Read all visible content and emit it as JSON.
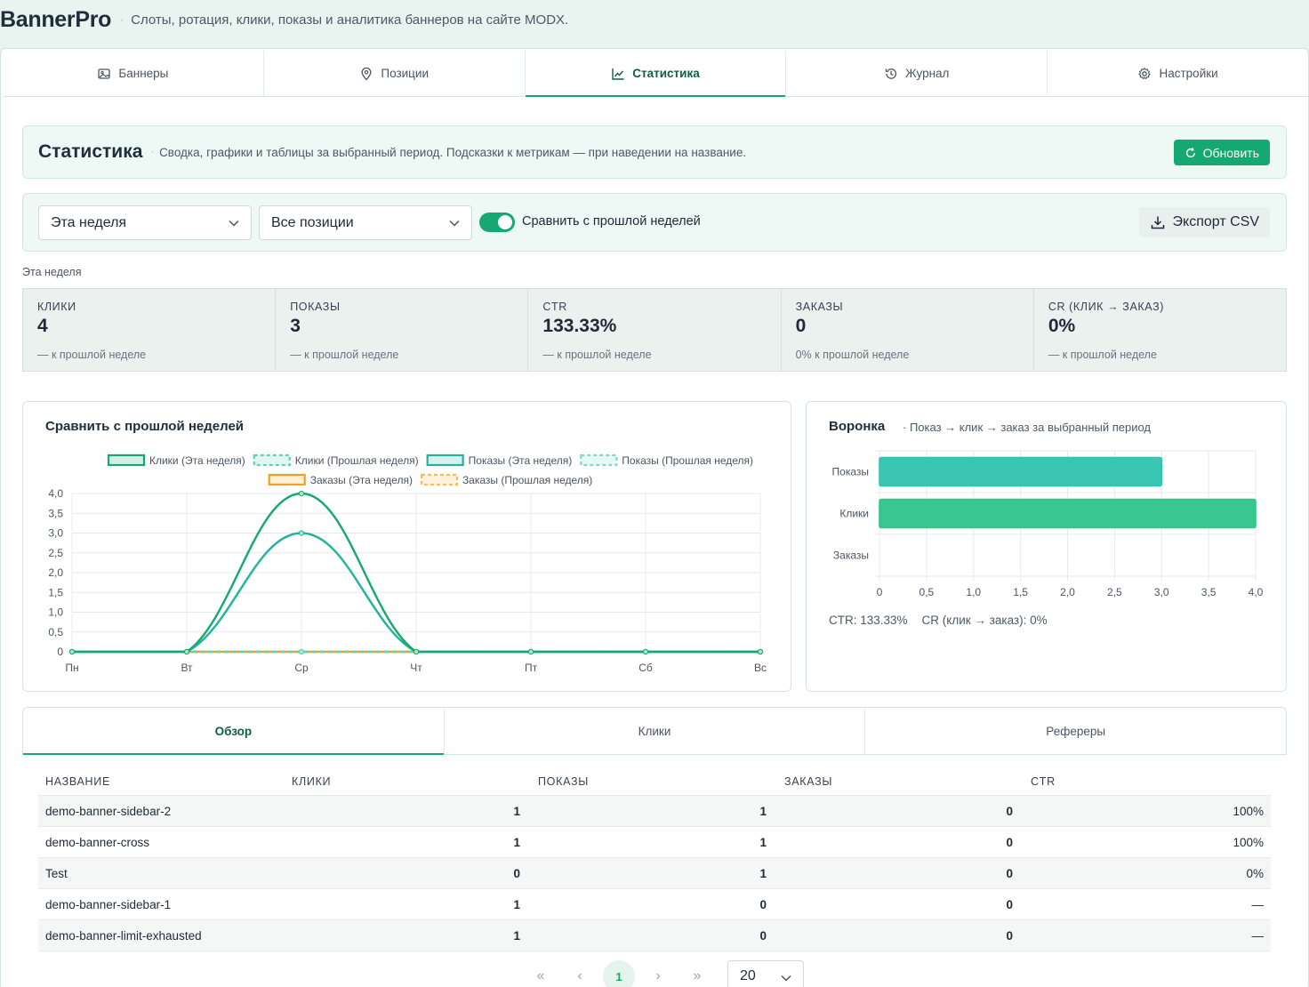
{
  "app": {
    "title": "BannerPro",
    "separator": "·",
    "subtitle": "Слоты, ротация, клики, показы и аналитика баннеров на сайте MODX."
  },
  "top_tabs": [
    {
      "label": "Баннеры",
      "icon": "image-icon"
    },
    {
      "label": "Позиции",
      "icon": "map-pin-icon"
    },
    {
      "label": "Статистика",
      "icon": "chart-line-icon",
      "active": true
    },
    {
      "label": "Журнал",
      "icon": "history-icon"
    },
    {
      "label": "Настройки",
      "icon": "gear-icon"
    }
  ],
  "stats_header": {
    "title": "Статистика",
    "subtitle": "Сводка, графики и таблицы за выбранный период. Подсказки к метрикам — при наведении на название.",
    "refresh_label": "Обновить"
  },
  "filters": {
    "period_value": "Эта неделя",
    "position_value": "Все позиции",
    "compare_enabled": true,
    "compare_label": "Сравнить с прошлой неделей",
    "export_label": "Экспорт CSV"
  },
  "period_label": "Эта неделя",
  "kpis": [
    {
      "label": "КЛИКИ",
      "value": "4",
      "delta": "— к прошлой неделе"
    },
    {
      "label": "ПОКАЗЫ",
      "value": "3",
      "delta": "— к прошлой неделе"
    },
    {
      "label": "CTR",
      "value": "133.33%",
      "delta": "— к прошлой неделе"
    },
    {
      "label": "ЗАКАЗЫ",
      "value": "0",
      "delta": "0% к прошлой неделе"
    },
    {
      "label": "CR (КЛИК → ЗАКАЗ)",
      "value": "0%",
      "delta": "— к прошлой неделе"
    }
  ],
  "chart_data": [
    {
      "type": "line",
      "title": "Сравнить с прошлой неделей",
      "categories": [
        "Пн",
        "Вт",
        "Ср",
        "Чт",
        "Пт",
        "Сб",
        "Вс"
      ],
      "ylim": [
        0,
        4
      ],
      "yticks": [
        "0",
        "0,5",
        "1,0",
        "1,5",
        "2,0",
        "2,5",
        "3,0",
        "3,5",
        "4,0"
      ],
      "grid": true,
      "legend": "top",
      "series": [
        {
          "name": "Клики (Эта неделя)",
          "values": [
            0,
            0,
            4,
            0,
            0,
            0,
            0
          ],
          "color": "#16a873",
          "dashed": false
        },
        {
          "name": "Клики (Прошлая неделя)",
          "values": [
            0,
            0,
            0,
            0,
            0,
            0,
            0
          ],
          "color": "#5fd4b4",
          "dashed": true
        },
        {
          "name": "Показы (Эта неделя)",
          "values": [
            0,
            0,
            3,
            0,
            0,
            0,
            0
          ],
          "color": "#21b39e",
          "dashed": false
        },
        {
          "name": "Показы (Прошлая неделя)",
          "values": [
            0,
            0,
            0,
            0,
            0,
            0,
            0
          ],
          "color": "#7fd9cc",
          "dashed": true
        },
        {
          "name": "Заказы (Эта неделя)",
          "values": [
            0,
            0,
            0,
            0,
            0,
            0,
            0
          ],
          "color": "#f0a020",
          "dashed": false
        },
        {
          "name": "Заказы (Прошлая неделя)",
          "values": [
            0,
            0,
            0,
            0,
            0,
            0,
            0
          ],
          "color": "#f5bd55",
          "dashed": true
        }
      ]
    },
    {
      "type": "bar",
      "orientation": "horizontal",
      "title": "Воронка",
      "subtitle": "Показ → клик → заказ за выбранный период",
      "categories": [
        "Показы",
        "Клики",
        "Заказы"
      ],
      "values": [
        3,
        4,
        0
      ],
      "colors": [
        "#2ec4b0",
        "#2ec48a",
        "#f0a020"
      ],
      "xlim": [
        0,
        4
      ],
      "xticks": [
        "0",
        "0,5",
        "1,0",
        "1,5",
        "2,0",
        "2,5",
        "3,0",
        "3,5",
        "4,0"
      ],
      "grid": true
    }
  ],
  "funnel_footer": {
    "ctr": "CTR: 133.33%",
    "cr": "CR (клик → заказ): 0%"
  },
  "sub_tabs": [
    {
      "label": "Обзор",
      "active": true
    },
    {
      "label": "Клики"
    },
    {
      "label": "Рефереры"
    }
  ],
  "table": {
    "headers": [
      "НАЗВАНИЕ",
      "КЛИКИ",
      "ПОКАЗЫ",
      "ЗАКАЗЫ",
      "CTR"
    ],
    "rows": [
      [
        "demo-banner-sidebar-2",
        "1",
        "1",
        "0",
        "100%"
      ],
      [
        "demo-banner-cross",
        "1",
        "1",
        "0",
        "100%"
      ],
      [
        "Test",
        "0",
        "1",
        "0",
        "0%"
      ],
      [
        "demo-banner-sidebar-1",
        "1",
        "0",
        "0",
        "—"
      ],
      [
        "demo-banner-limit-exhausted",
        "1",
        "0",
        "0",
        "—"
      ]
    ]
  },
  "pagination": {
    "first": "«",
    "prev": "‹",
    "current": "1",
    "next": "›",
    "last": "»",
    "page_size": "20"
  }
}
